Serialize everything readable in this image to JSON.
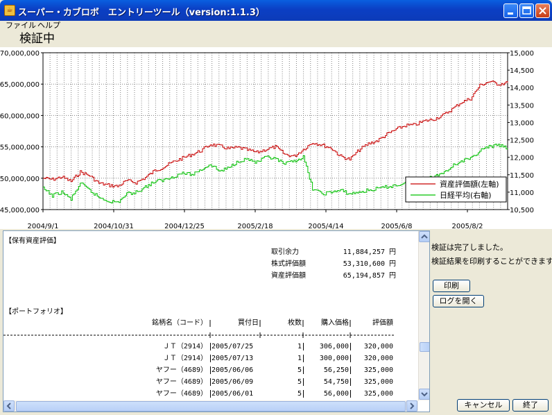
{
  "window": {
    "title": "スーパー・カブロボ　エントリーツール（version:1.1.3）",
    "icon": "java-cup-icon"
  },
  "menu": [
    {
      "label": "ファイル"
    },
    {
      "label": "ヘルプ"
    }
  ],
  "status": {
    "title": "検証中"
  },
  "chart_data": {
    "type": "line",
    "x_tick_labels": [
      "2004/9/1",
      "2004/10/31",
      "2004/12/25",
      "2005/2/18",
      "2005/4/14",
      "2005/6/8",
      "2005/8/2"
    ],
    "left_axis": {
      "ticks": [
        "45,000,000",
        "50,000,000",
        "55,000,000",
        "60,000,000",
        "65,000,000",
        "70,000,000"
      ],
      "ylim": [
        45000000,
        70000000
      ]
    },
    "right_axis": {
      "ticks": [
        "10,500",
        "11,000",
        "11,500",
        "12,000",
        "12,500",
        "13,000",
        "13,500",
        "14,000",
        "14,500",
        "15,000"
      ],
      "ylim": [
        10500,
        15000
      ]
    },
    "grid": true,
    "legend_position": "bottom-right",
    "series": [
      {
        "name": "資産評価額(左軸)",
        "axis": "left",
        "color": "#c80000",
        "values": [
          50000000,
          49800000,
          50200000,
          49500000,
          51000000,
          50400000,
          49200000,
          48900000,
          48700000,
          49600000,
          49300000,
          50100000,
          51200000,
          51800000,
          52600000,
          53200000,
          53800000,
          54400000,
          55400000,
          55100000,
          54700000,
          54900000,
          54500000,
          54100000,
          54600000,
          55000000,
          53800000,
          53500000,
          54600000,
          55700000,
          55300000,
          54800000,
          53500000,
          53000000,
          54500000,
          55500000,
          56000000,
          57000000,
          57800000,
          58400000,
          58500000,
          59100000,
          59400000,
          60000000,
          61000000,
          62100000,
          62700000,
          64800000,
          65400000,
          65000000,
          65200000
        ]
      },
      {
        "name": "日経平均(右軸)",
        "axis": "right",
        "color": "#00c000",
        "values": [
          11100,
          10900,
          11000,
          10800,
          11250,
          11050,
          10850,
          10750,
          10700,
          10950,
          11000,
          11150,
          11300,
          11350,
          11450,
          11550,
          11500,
          11650,
          11800,
          11600,
          11700,
          11900,
          11950,
          11850,
          12000,
          11950,
          11800,
          11900,
          12000,
          11100,
          10950,
          11000,
          11050,
          10950,
          11000,
          11050,
          11100,
          11150,
          11200,
          11250,
          11300,
          11350,
          11450,
          11550,
          11750,
          11900,
          11950,
          12200,
          12300,
          12350,
          12250
        ]
      }
    ]
  },
  "report": {
    "section_assets": "【保有資産評価】",
    "assets": [
      {
        "label": "取引余力",
        "value": "11,884,257",
        "unit": "円"
      },
      {
        "label": "株式評価額",
        "value": "53,310,600",
        "unit": "円"
      },
      {
        "label": "資産評価額",
        "value": "65,194,857",
        "unit": "円"
      }
    ],
    "section_portfolio": "【ポートフォリオ】",
    "columns": [
      "銘柄名（コード）",
      "買付日",
      "枚数",
      "購入価格",
      "評価額"
    ],
    "rows": [
      {
        "name": "ＪＴ（2914）",
        "date": "2005/07/25",
        "qty": "1",
        "price": "306,000",
        "value": "320,000"
      },
      {
        "name": "ＪＴ（2914）",
        "date": "2005/07/13",
        "qty": "1",
        "price": "300,000",
        "value": "320,000"
      },
      {
        "name": "ヤフー（4689）",
        "date": "2005/06/06",
        "qty": "5",
        "price": "56,250",
        "value": "325,000"
      },
      {
        "name": "ヤフー（4689）",
        "date": "2005/06/09",
        "qty": "5",
        "price": "54,750",
        "value": "325,000"
      },
      {
        "name": "ヤフー（4689）",
        "date": "2005/06/01",
        "qty": "5",
        "price": "56,000",
        "value": "325,000"
      }
    ]
  },
  "messages": [
    "検証は完了しました。",
    "検証結果を印刷することができます。"
  ],
  "buttons": {
    "print": "印刷",
    "open_log": "ログを開く",
    "cancel": "キャンセル",
    "finish": "終了"
  }
}
